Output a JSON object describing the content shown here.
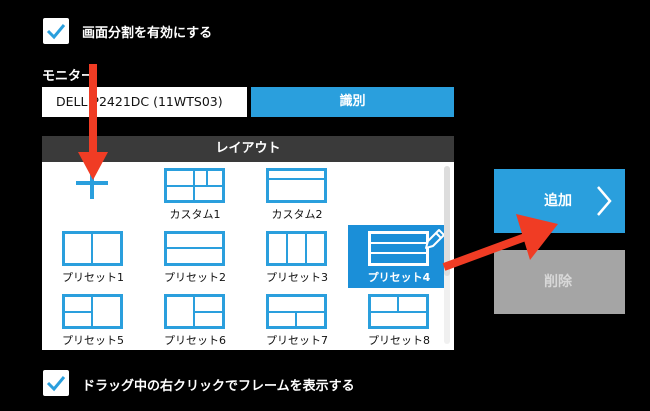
{
  "split_screen": {
    "label": "画面分割を有効にする",
    "checked": true
  },
  "monitor": {
    "label": "モニター",
    "selected": "DELL P2421DC (11WTS03)"
  },
  "identify_button": {
    "label": "識別"
  },
  "layout": {
    "header": "レイアウト",
    "items": [
      {
        "label": "",
        "kind": "add"
      },
      {
        "label": "カスタム1",
        "kind": "custom1"
      },
      {
        "label": "カスタム2",
        "kind": "custom2"
      },
      {
        "label": "プリセット1",
        "kind": "preset1"
      },
      {
        "label": "プリセット2",
        "kind": "preset2"
      },
      {
        "label": "プリセット3",
        "kind": "preset3"
      },
      {
        "label": "プリセット4",
        "kind": "preset4",
        "selected": true
      },
      {
        "label": "プリセット5",
        "kind": "preset5"
      },
      {
        "label": "プリセット6",
        "kind": "preset6"
      },
      {
        "label": "プリセット7",
        "kind": "preset7"
      },
      {
        "label": "プリセット8",
        "kind": "preset8"
      }
    ]
  },
  "add_button": {
    "label": "追加"
  },
  "delete_button": {
    "label": "削除",
    "enabled": false
  },
  "drag_frame": {
    "label": "ドラッグ中の右クリックでフレームを表示する",
    "checked": true
  },
  "colors": {
    "accent": "#2a9fdd",
    "selected": "#1b8fd8",
    "annotation_arrow": "#f03c24",
    "disabled": "#a5a5a5"
  }
}
